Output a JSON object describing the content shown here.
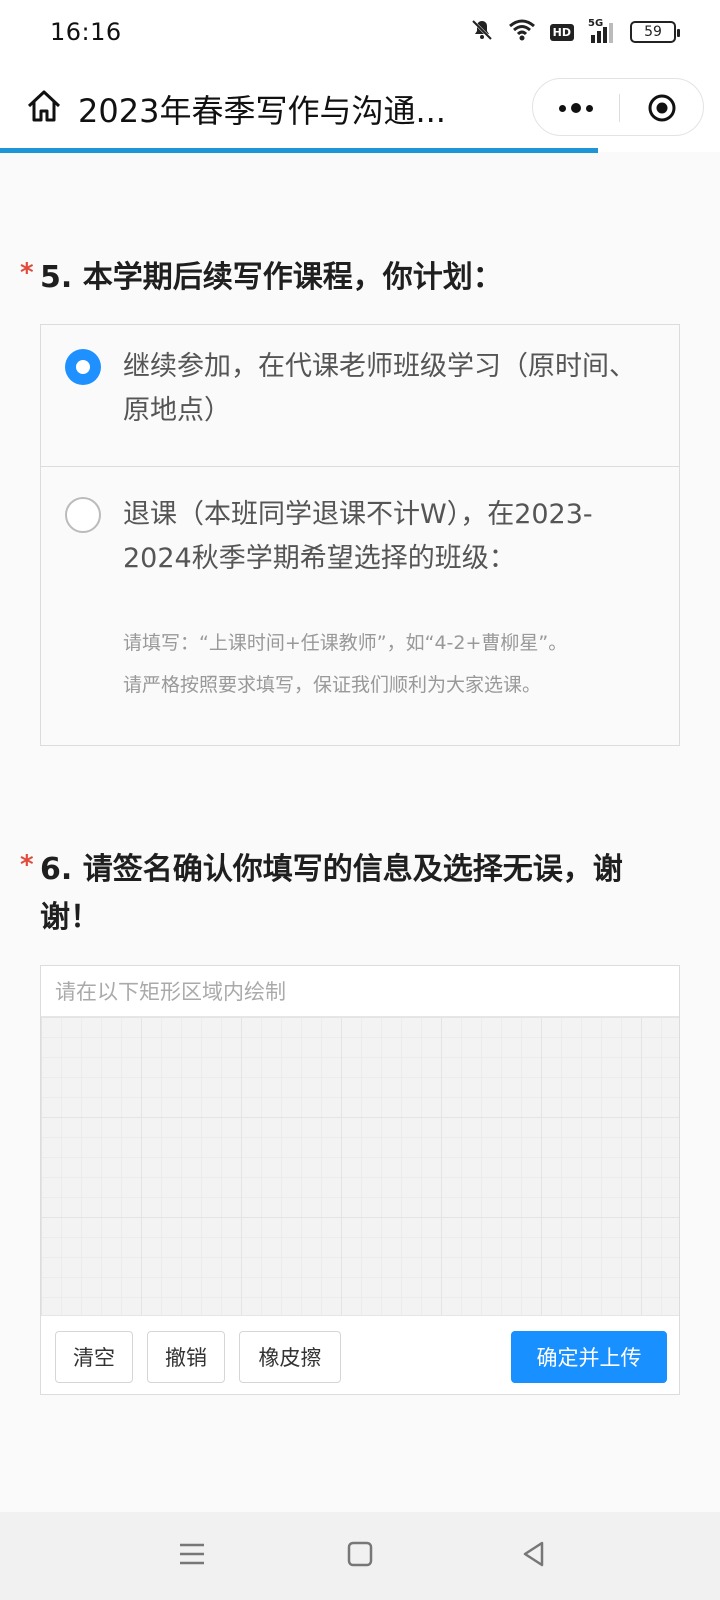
{
  "status_bar": {
    "time": "16:16",
    "network": "5G",
    "hd": "HD",
    "battery": "59"
  },
  "nav": {
    "title": "2023年春季写作与沟通..."
  },
  "question5": {
    "required_mark": "*",
    "title": "5. 本学期后续写作课程，你计划：",
    "options": [
      {
        "label": "继续参加，在代课老师班级学习（原时间、原地点）",
        "selected": true
      },
      {
        "label": "退课（本班同学退课不计W），在2023-2024秋季学期希望选择的班级：",
        "hint_1": "请填写：“上课时间+任课教师”，如“4-2+曹柳星”。",
        "hint_2": "请严格按照要求填写，保证我们顺利为大家选课。",
        "selected": false
      }
    ]
  },
  "question6": {
    "required_mark": "*",
    "title": "6. 请签名确认你填写的信息及选择无误，谢谢！",
    "signature_hint": "请在以下矩形区域内绘制",
    "buttons": {
      "clear": "清空",
      "undo": "撤销",
      "eraser": "橡皮擦",
      "confirm": "确定并上传"
    }
  },
  "colors": {
    "accent": "#1890ff",
    "required": "#e24a3b",
    "progress": "#1e96d6"
  }
}
